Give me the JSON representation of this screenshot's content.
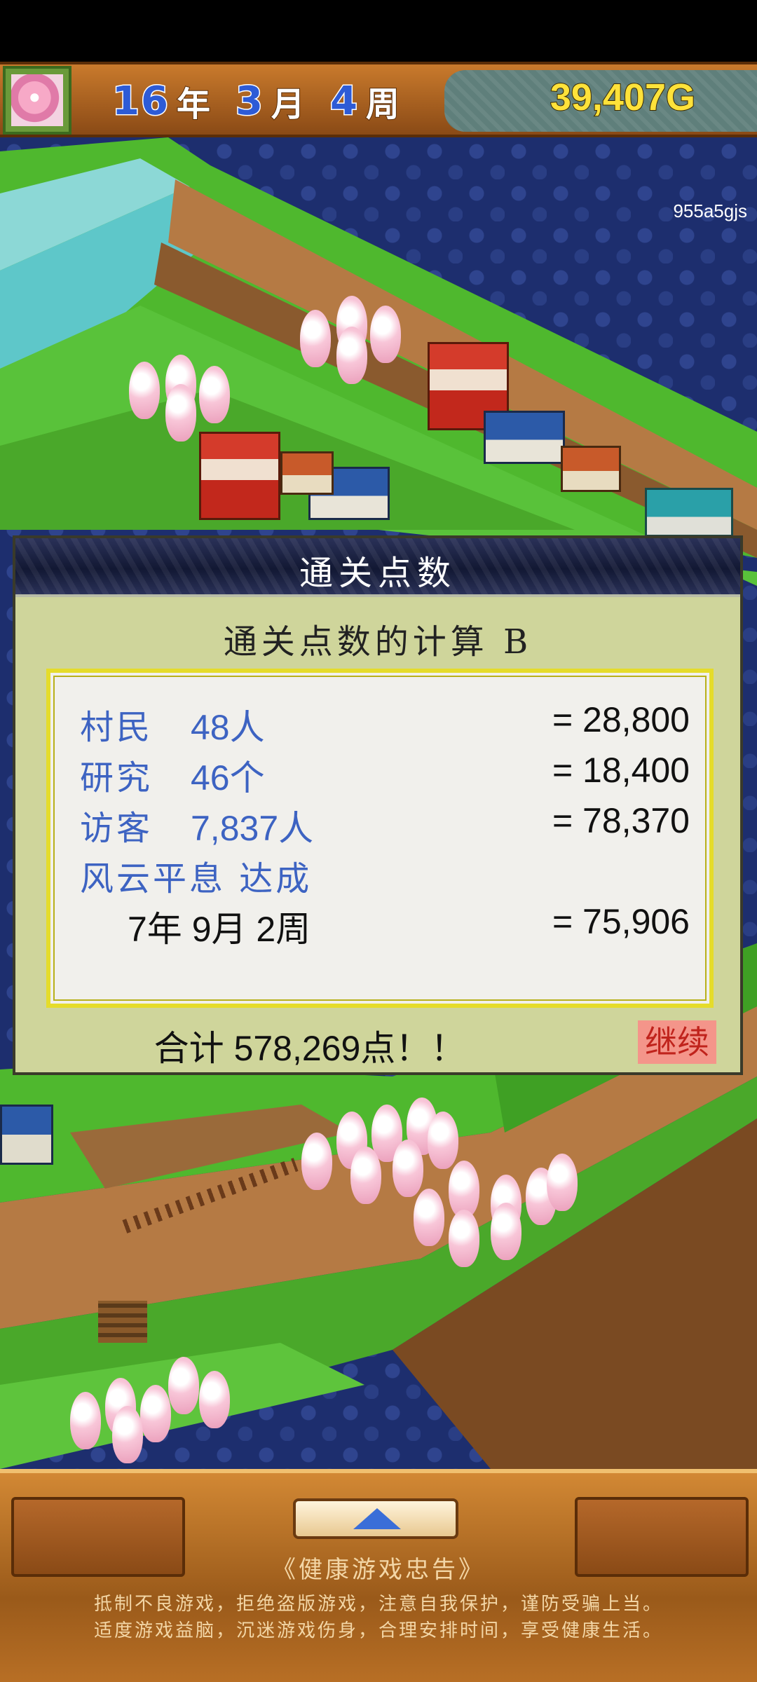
{
  "header": {
    "year": "16",
    "year_unit": "年",
    "month": "3",
    "month_unit": "月",
    "week": "4",
    "week_unit": "周",
    "money": "39,407G"
  },
  "map": {
    "id_label": "955a5gjs"
  },
  "dialog": {
    "title": "通关点数",
    "subtitle": "通关点数的计算 B",
    "rows": [
      {
        "label": "村民",
        "value": "48人",
        "points": "= 28,800"
      },
      {
        "label": "研究",
        "value": "46个",
        "points": "= 18,400"
      },
      {
        "label": "访客",
        "value": "7,837人",
        "points": "= 78,370"
      }
    ],
    "achievement": {
      "label": "风云平息 达成",
      "date": "7年 9月 2周",
      "points": "= 75,906"
    },
    "total": "合计 578,269点！！",
    "continue_label": "继续"
  },
  "footer": {
    "notice_title": "《健康游戏忠告》",
    "notice_line1": "抵制不良游戏，拒绝盗版游戏，注意自我保护，谨防受骗上当。",
    "notice_line2": "适度游戏益脑，沉迷游戏伤身，合理安排时间，享受健康生活。"
  },
  "colors": {
    "dialog_bg": "#cfd59b",
    "label_blue": "#3d63c2",
    "continue_bg": "#f4958a",
    "money_yellow": "#ffe23a"
  }
}
